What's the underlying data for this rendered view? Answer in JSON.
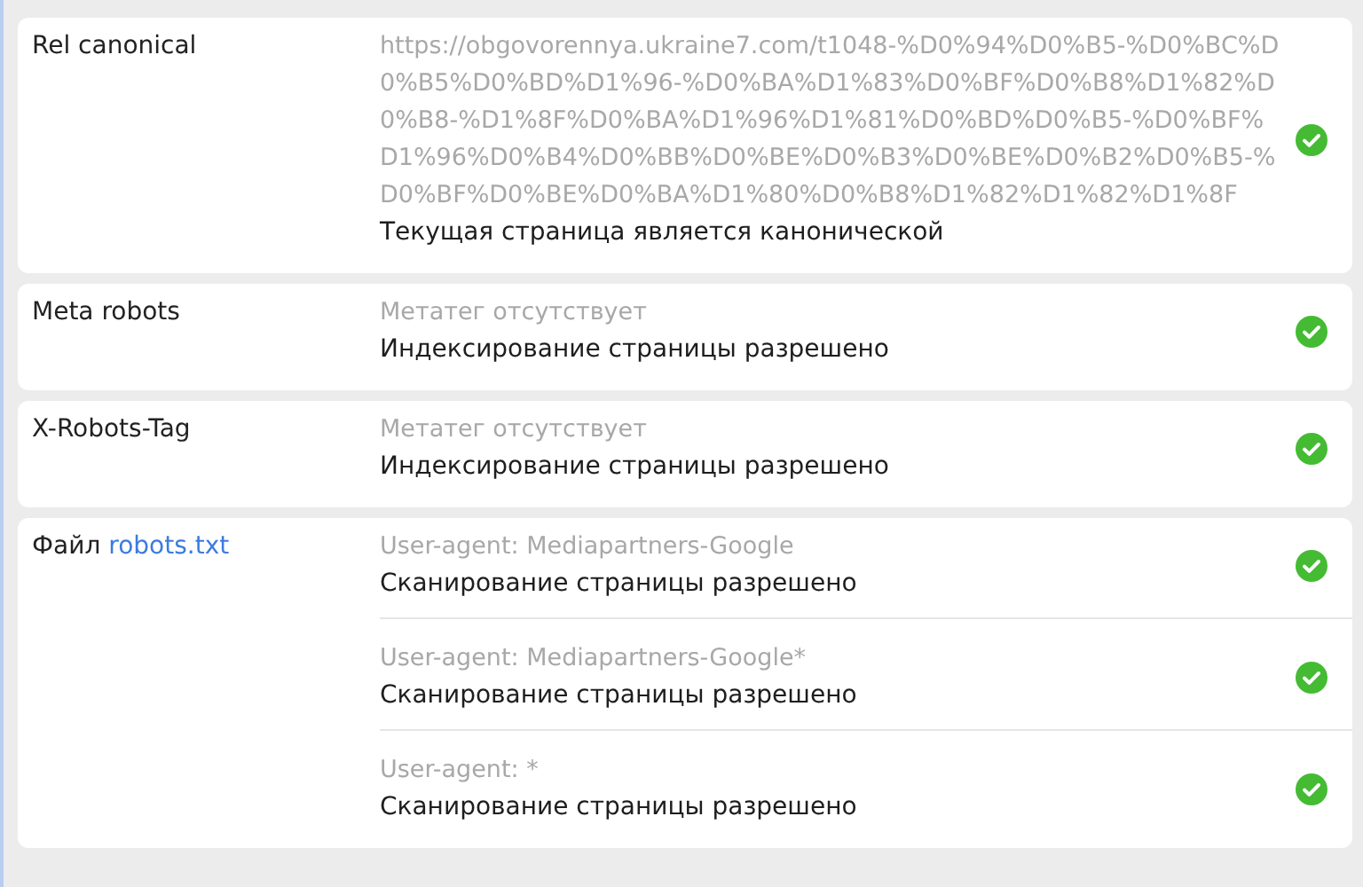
{
  "rows": [
    {
      "label": "Rel canonical",
      "entries": [
        {
          "detail": "https://obgovorennya.ukraine7.com/t1048-%D0%94%D0%B5-%D0%BC%D0%B5%D0%BD%D1%96-%D0%BA%D1%83%D0%BF%D0%B8%D1%82%D0%B8-%D1%8F%D0%BA%D1%96%D1%81%D0%BD%D0%B5-%D0%BF%D1%96%D0%B4%D0%BB%D0%BE%D0%B3%D0%BE%D0%B2%D0%B5-%D0%BF%D0%BE%D0%BA%D1%80%D0%B8%D1%82%D1%82%D1%8F",
          "result": "Текущая страница является канонической",
          "passed": true
        }
      ]
    },
    {
      "label": "Meta robots",
      "entries": [
        {
          "detail": "Метатег отсутствует",
          "result": "Индексирование страницы разрешено",
          "passed": true
        }
      ]
    },
    {
      "label": "X-Robots-Tag",
      "entries": [
        {
          "detail": "Метатег отсутствует",
          "result": "Индексирование страницы разрешено",
          "passed": true
        }
      ]
    },
    {
      "label": "Файл",
      "label_link": "robots.txt",
      "entries": [
        {
          "detail": "User-agent: Mediapartners-Google",
          "result": "Сканирование страницы разрешено",
          "passed": true
        },
        {
          "detail": "User-agent: Mediapartners-Google*",
          "result": "Сканирование страницы разрешено",
          "passed": true
        },
        {
          "detail": "User-agent: *",
          "result": "Сканирование страницы разрешено",
          "passed": true
        }
      ]
    }
  ]
}
